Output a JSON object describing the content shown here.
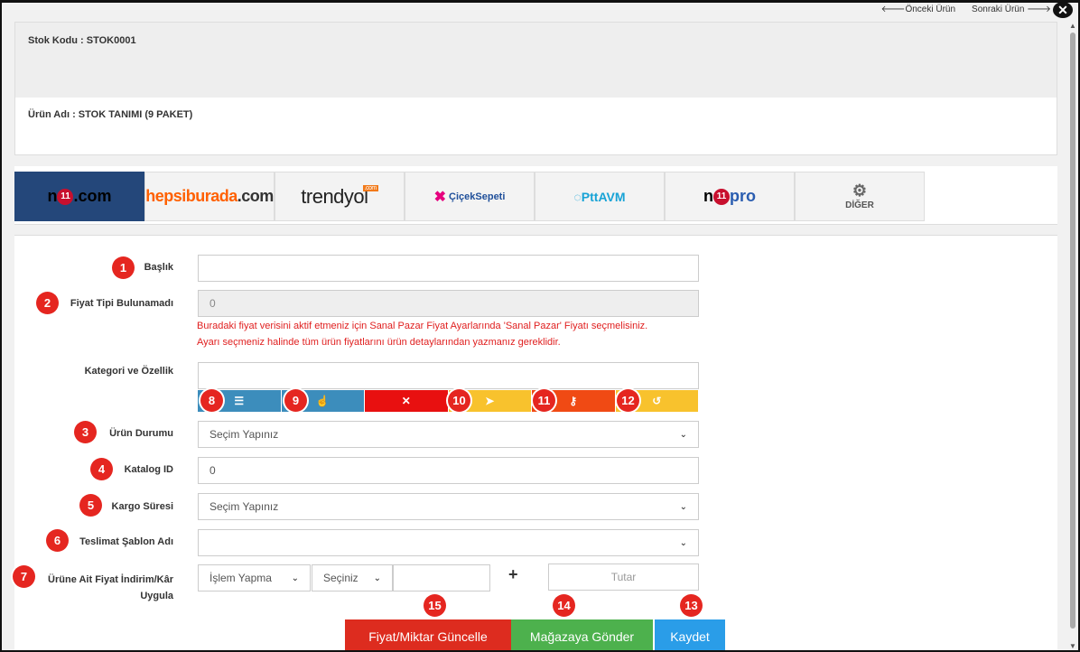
{
  "nav": {
    "prev_label": "🡐Önceki Ürün",
    "next_label": "Sonraki Ürün 🡒",
    "close_label": "✕"
  },
  "product": {
    "stock_code_label": "Stok Kodu : STOK0001",
    "product_name_label": "Ürün Adı : STOK TANIMI (9 PAKET)"
  },
  "marketplaces": [
    {
      "name": "n11.com"
    },
    {
      "name": "hepsiburada.com"
    },
    {
      "name": "trendyol"
    },
    {
      "name": "ÇiçekSepeti.com"
    },
    {
      "name": "PttAVM.com"
    },
    {
      "name": "n11pro"
    },
    {
      "name": "DİĞER"
    }
  ],
  "form": {
    "title_label": "Başlık",
    "title_value": "",
    "price_type_label": "Fiyat Tipi Bulunamadı",
    "price_type_value": "0",
    "warning_line1": "Buradaki fiyat verisini aktif etmeniz için Sanal Pazar Fiyat Ayarlarında 'Sanal Pazar' Fiyatı seçmelisiniz.",
    "warning_line2": "Ayarı seçmeniz halinde tüm ürün fiyatlarını ürün detaylarından yazmanız gereklidir.",
    "category_label": "Kategori ve Özellik",
    "status_label": "Ürün Durumu",
    "status_value": "Seçim Yapınız",
    "catalog_label": "Katalog ID",
    "catalog_value": "0",
    "cargo_label": "Kargo Süresi",
    "cargo_value": "Seçim Yapınız",
    "delivery_label": "Teslimat Şablon Adı",
    "delivery_value": "",
    "discount_label_1": "Ürüne Ait Fiyat İndirim/Kâr",
    "discount_label_2": "Uygula",
    "discount_op_value": "İşlem Yapma",
    "discount_type_value": "Seçiniz",
    "discount_amount_placeholder": "Tutar",
    "plus_sign": "+"
  },
  "buttons": {
    "update_price": "Fiyat/Miktar Güncelle",
    "send_store": "Mağazaya Gönder",
    "save": "Kaydet"
  },
  "badges": [
    "1",
    "2",
    "3",
    "4",
    "5",
    "6",
    "7",
    "8",
    "9",
    "10",
    "11",
    "12",
    "13",
    "14",
    "15"
  ],
  "colors": {
    "badge": "#e52620",
    "active_tab": "#24477a",
    "warning_text": "#e02020",
    "btn_update": "#dd2c1f",
    "btn_send": "#4db14d",
    "btn_save": "#2a9de8"
  }
}
